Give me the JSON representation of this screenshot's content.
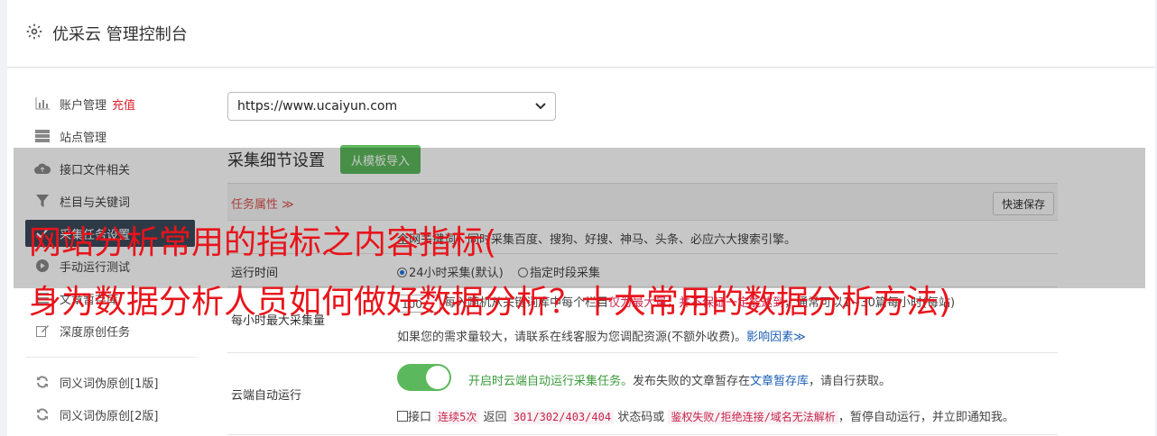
{
  "header": {
    "title": "优采云 管理控制台",
    "icon": "gear-icon"
  },
  "sidebar": {
    "items": [
      {
        "label": "账户管理",
        "extra": "充值",
        "icon": "bar-chart-icon"
      },
      {
        "label": "站点管理",
        "icon": "server-icon"
      },
      {
        "label": "接口文件相关",
        "icon": "cloud-upload-icon"
      },
      {
        "label": "栏目与关键词",
        "icon": "filter-icon"
      },
      {
        "label": "采集任务设置",
        "icon": "tasks-icon",
        "active": true
      },
      {
        "label": "手动运行测试",
        "icon": "play-circle-icon"
      },
      {
        "label": "文章暂存库",
        "icon": "list-icon"
      },
      {
        "label": "深度原创任务",
        "icon": "edit-icon"
      },
      {
        "label": "同义词伪原创[1版]",
        "icon": "refresh-icon"
      },
      {
        "label": "同义词伪原创[2版]",
        "icon": "refresh-icon"
      }
    ]
  },
  "main": {
    "site_select": "https://www.ucaiyun.com",
    "section_title": "采集细节设置",
    "import_button": "从模板导入",
    "task_attr": "任务属性 ≫",
    "quick_save": "快速保存",
    "engines_text": "全网关键词，同时采集百度、搜狗、好搜、神马、头条、必应六大搜索引擎。",
    "run_time": {
      "label": "运行时间",
      "option1": "24小时采集(默认)",
      "option2": "指定时段采集"
    },
    "hourly": {
      "label": "每小时最大采集量",
      "value": "100",
      "text1": "每入随机从关键词库中每个栏目",
      "highlight": "仅为最大量，并不保证一定能达到",
      "text2": "，通常可以1~30篇每小时(每站)",
      "note": "如果您的需求量较大，请联系在线客服为您调配资源(不额外收费)。",
      "link": "影响因素≫"
    },
    "cloud": {
      "label": "云端自动运行",
      "enabled_text": "开启时云端自动运行采集任务。",
      "desc": "发布失败的文章暂存在",
      "link": "文章暂存库",
      "desc2": "，请自行获取。",
      "chk_prefix": "接口",
      "code1": "连续5次",
      "mid1": "返回",
      "code2": "301/302/403/404",
      "mid2": "状态码或",
      "code3": "鉴权失败/拒绝连接/域名无法解析",
      "tail": "，暂停自动运行，并立即通知我。"
    }
  },
  "watermark": {
    "line1": "网站分析常用的指标之内容指标(",
    "line2": "身为数据分析人员如何做好数据分析？十大常用的数据分析方法)"
  }
}
